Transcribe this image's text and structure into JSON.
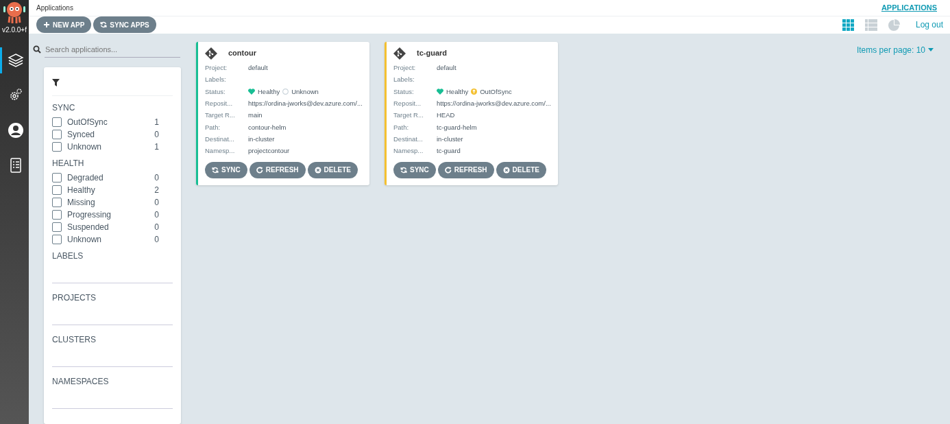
{
  "sidebar": {
    "version": "v2.0.0+f",
    "items": [
      {
        "kind": "layers",
        "selected": true
      },
      {
        "kind": "gears",
        "selected": false
      },
      {
        "kind": "user",
        "selected": false
      },
      {
        "kind": "docs",
        "selected": false
      }
    ]
  },
  "header": {
    "title": "Applications",
    "link": "APPLICATIONS"
  },
  "toolbar": {
    "buttons": [
      {
        "kind": "plus",
        "label": "NEW APP"
      },
      {
        "kind": "sync",
        "label": "SYNC APPS"
      }
    ],
    "views": [
      {
        "kind": "tiles",
        "selected": true
      },
      {
        "kind": "list",
        "selected": false
      },
      {
        "kind": "pie",
        "selected": false
      }
    ],
    "logout": "Log out"
  },
  "search": {
    "placeholder": "Search applications..."
  },
  "pager": {
    "label": "Items per page: 10"
  },
  "filters": [
    {
      "title": "SYNC",
      "kind": "checklist",
      "items": [
        {
          "label": "OutOfSync",
          "count": "1",
          "checked": false
        },
        {
          "label": "Synced",
          "count": "0",
          "checked": false
        },
        {
          "label": "Unknown",
          "count": "1",
          "checked": false
        }
      ]
    },
    {
      "title": "HEALTH",
      "kind": "checklist",
      "items": [
        {
          "label": "Degraded",
          "count": "0",
          "checked": false
        },
        {
          "label": "Healthy",
          "count": "2",
          "checked": false
        },
        {
          "label": "Missing",
          "count": "0",
          "checked": false
        },
        {
          "label": "Progressing",
          "count": "0",
          "checked": false
        },
        {
          "label": "Suspended",
          "count": "0",
          "checked": false
        },
        {
          "label": "Unknown",
          "count": "0",
          "checked": false
        }
      ]
    },
    {
      "title": "LABELS",
      "kind": "field"
    },
    {
      "title": "PROJECTS",
      "kind": "field"
    },
    {
      "title": "CLUSTERS",
      "kind": "field"
    },
    {
      "title": "NAMESPACES",
      "kind": "field"
    }
  ],
  "apps": [
    {
      "name": "contour",
      "kind": "unknown",
      "fields": [
        {
          "label": "Project:",
          "value": "default"
        },
        {
          "label": "Labels:"
        },
        {
          "label": "Status:",
          "kind": "status",
          "health": "Healthy",
          "sync": "Unknown"
        },
        {
          "label": "Reposit...",
          "value": "https://ordina-jworks@dev.azure.com/..."
        },
        {
          "label": "Target R...",
          "value": "main"
        },
        {
          "label": "Path:",
          "value": "contour-helm"
        },
        {
          "label": "Destinat...",
          "value": "in-cluster"
        },
        {
          "label": "Namesp...",
          "value": "projectcontour"
        }
      ],
      "actions": [
        {
          "kind": "sync",
          "label": "SYNC"
        },
        {
          "kind": "refresh",
          "label": "REFRESH"
        },
        {
          "kind": "delete",
          "label": "DELETE"
        }
      ]
    },
    {
      "name": "tc-guard",
      "kind": "outofsync",
      "fields": [
        {
          "label": "Project:",
          "value": "default"
        },
        {
          "label": "Labels:"
        },
        {
          "label": "Status:",
          "kind": "status",
          "health": "Healthy",
          "sync": "OutOfSync"
        },
        {
          "label": "Reposit...",
          "value": "https://ordina-jworks@dev.azure.com/..."
        },
        {
          "label": "Target R...",
          "value": "HEAD"
        },
        {
          "label": "Path:",
          "value": "tc-guard-helm"
        },
        {
          "label": "Destinat...",
          "value": "in-cluster"
        },
        {
          "label": "Namesp...",
          "value": "tc-guard"
        }
      ],
      "actions": [
        {
          "kind": "sync",
          "label": "SYNC"
        },
        {
          "kind": "refresh",
          "label": "REFRESH"
        },
        {
          "kind": "delete",
          "label": "DELETE"
        }
      ]
    }
  ]
}
